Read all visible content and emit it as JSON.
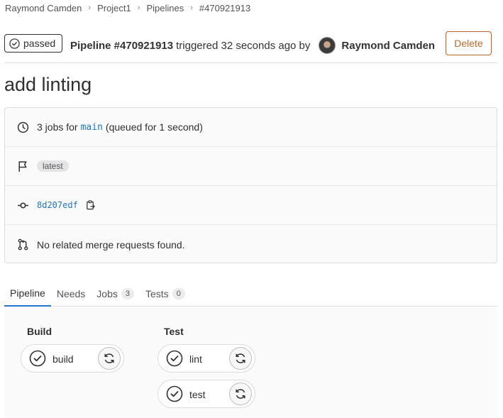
{
  "breadcrumb": [
    "Raymond Camden",
    "Project1",
    "Pipelines",
    "#470921913"
  ],
  "header": {
    "status": "passed",
    "pipeline_label": "Pipeline #470921913",
    "triggered_text": "triggered 32 seconds ago by",
    "author": "Raymond Camden",
    "delete_label": "Delete"
  },
  "title": "add linting",
  "info": {
    "jobs_prefix": "3 jobs for",
    "branch": "main",
    "jobs_suffix": "(queued for 1 second)",
    "tag": "latest",
    "sha": "8d207edf",
    "merge_requests": "No related merge requests found."
  },
  "tabs": [
    {
      "label": "Pipeline"
    },
    {
      "label": "Needs"
    },
    {
      "label": "Jobs",
      "count": "3"
    },
    {
      "label": "Tests",
      "count": "0"
    }
  ],
  "stages": [
    {
      "title": "Build",
      "jobs": [
        {
          "name": "build"
        }
      ]
    },
    {
      "title": "Test",
      "jobs": [
        {
          "name": "lint"
        },
        {
          "name": "test"
        }
      ]
    }
  ],
  "icons": {
    "status": "check-circle-icon",
    "clock": "clock-icon",
    "flag": "flag-icon",
    "commit": "commit-icon",
    "copy": "copy-icon",
    "merge_request": "merge-request-icon",
    "retry": "retry-icon"
  },
  "colors": {
    "link": "#1f75cb",
    "danger": "#c0682a",
    "active_tab": "#1f75cb"
  }
}
